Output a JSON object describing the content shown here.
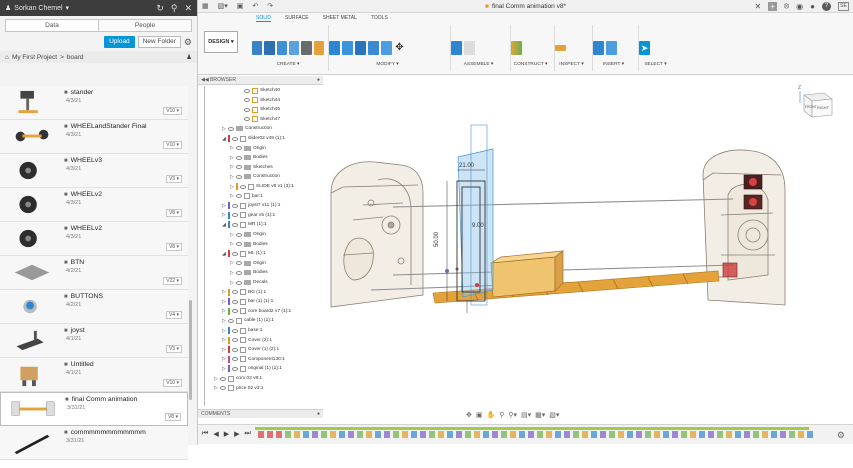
{
  "data_panel": {
    "user": "Sorkan Chemel",
    "tabs": [
      "Data",
      "People"
    ],
    "upload_label": "Upload",
    "new_folder_label": "New Folder",
    "breadcrumb": [
      "My First Project",
      "board"
    ],
    "files": [
      {
        "name": "stander",
        "date": "4/3/21",
        "version": "V10",
        "thumb": "stander"
      },
      {
        "name": "WHEELandStander Final",
        "date": "4/3/21",
        "version": "V10",
        "thumb": "wheels"
      },
      {
        "name": "WHEELv3",
        "date": "4/3/21",
        "version": "V3",
        "thumb": "wheel"
      },
      {
        "name": "WHEELv2",
        "date": "4/3/21",
        "version": "V8",
        "thumb": "wheel"
      },
      {
        "name": "WHEELv2",
        "date": "4/3/21",
        "version": "V8",
        "thumb": "wheel"
      },
      {
        "name": "BTN",
        "date": "4/2/21",
        "version": "V22",
        "thumb": "plate"
      },
      {
        "name": "BUTTONS",
        "date": "4/2/21",
        "version": "V4",
        "thumb": "button"
      },
      {
        "name": "joyst",
        "date": "4/1/21",
        "version": "V3",
        "thumb": "joyst"
      },
      {
        "name": "Untitled",
        "date": "4/1/21",
        "version": "V10",
        "thumb": "robot"
      },
      {
        "name": "final Comm animation",
        "date": "3/31/21",
        "version": "V8",
        "thumb": "anim",
        "selected": true
      },
      {
        "name": "commmmmmmmmmmm",
        "date": "3/31/21",
        "version": "",
        "thumb": "pen"
      }
    ]
  },
  "app": {
    "document_title": "final Comm animation v8*",
    "workspace_button": "DESIGN",
    "ribbon_tabs": [
      "SOLID",
      "SURFACE",
      "SHEET METAL",
      "TOOLS"
    ],
    "active_tab": "SOLID",
    "groups": [
      "CREATE",
      "MODIFY",
      "ASSEMBLE",
      "CONSTRUCT",
      "INSPECT",
      "INSERT",
      "SELECT"
    ],
    "browser_title": "BROWSER",
    "comments_label": "COMMENTS",
    "viewcube_labels": {
      "front": "FRONT",
      "right": "RIGHT",
      "z": "Z"
    },
    "dimensions": {
      "width": "21.00",
      "height": "50.00",
      "side": "9.00"
    },
    "tree": [
      {
        "label": "Sketch40",
        "depth": 3,
        "type": "sketch"
      },
      {
        "label": "Sketch44",
        "depth": 3,
        "type": "sketch"
      },
      {
        "label": "Sketch45",
        "depth": 3,
        "type": "sketch"
      },
      {
        "label": "Sketch47",
        "depth": 3,
        "type": "sketch"
      },
      {
        "label": "Construction",
        "depth": 1,
        "type": "folder",
        "tri": "▷"
      },
      {
        "label": "slider02 v49 (1):1",
        "depth": 1,
        "type": "comp",
        "tri": "◢",
        "color": "#d43d3d"
      },
      {
        "label": "Origin",
        "depth": 2,
        "type": "folder",
        "tri": "▷"
      },
      {
        "label": "Bodies",
        "depth": 2,
        "type": "folder",
        "tri": "▷"
      },
      {
        "label": "Sketches",
        "depth": 2,
        "type": "folder",
        "tri": "▷"
      },
      {
        "label": "Construction",
        "depth": 2,
        "type": "folder",
        "tri": "▷"
      },
      {
        "label": "SLIDE v8 v1 (3):1",
        "depth": 2,
        "type": "comp",
        "tri": "▷",
        "color": "#e39a1e"
      },
      {
        "label": "bar:1",
        "depth": 2,
        "type": "comp",
        "tri": "▷"
      },
      {
        "label": "joyst7 v11 (1):1",
        "depth": 1,
        "type": "comp",
        "tri": "▷",
        "color": "#7b5cc9"
      },
      {
        "label": "gear v5 (1):1",
        "depth": 1,
        "type": "comp",
        "tri": "▷",
        "color": "#2d86d2"
      },
      {
        "label": "MR (1):1",
        "depth": 1,
        "type": "comp",
        "tri": "◢",
        "color": "#2d86d2"
      },
      {
        "label": "Origin",
        "depth": 2,
        "type": "folder",
        "tri": "▷"
      },
      {
        "label": "Bodies",
        "depth": 2,
        "type": "folder",
        "tri": "▷"
      },
      {
        "label": "ML (1):1",
        "depth": 1,
        "type": "comp",
        "tri": "◢",
        "color": "#d43d3d"
      },
      {
        "label": "Origin",
        "depth": 2,
        "type": "folder",
        "tri": "▷"
      },
      {
        "label": "Bodies",
        "depth": 2,
        "type": "folder",
        "tri": "▷"
      },
      {
        "label": "Decals",
        "depth": 2,
        "type": "folder",
        "tri": "▷"
      },
      {
        "label": "BG (1):1",
        "depth": 1,
        "type": "comp",
        "tri": "▷",
        "color": "#e39a1e"
      },
      {
        "label": "bar (1) (1):1",
        "depth": 1,
        "type": "comp",
        "tri": "▷",
        "color": "#7b5cc9"
      },
      {
        "label": "core board2 v7 (1):1",
        "depth": 1,
        "type": "comp",
        "tri": "▷",
        "color": "#6ab04c"
      },
      {
        "label": "cable (1) (1):1",
        "depth": 1,
        "type": "comp",
        "tri": "▷"
      },
      {
        "label": "base:1",
        "depth": 1,
        "type": "comp",
        "tri": "▷",
        "color": "#2d86d2"
      },
      {
        "label": "Cover (2):1",
        "depth": 1,
        "type": "comp",
        "tri": "▷",
        "color": "#e39a1e"
      },
      {
        "label": "Cover (1) (2):1",
        "depth": 1,
        "type": "comp",
        "tri": "▷",
        "color": "#d43d3d"
      },
      {
        "label": "Component130:1",
        "depth": 1,
        "type": "comp",
        "tri": "▷",
        "color": "#c44a9a"
      },
      {
        "label": "original (1) (1):1",
        "depth": 1,
        "type": "comp",
        "tri": "▷",
        "color": "#7b5cc9"
      },
      {
        "label": "com 03 v8:1",
        "depth": 0,
        "type": "comp",
        "tri": "▷"
      },
      {
        "label": "price 02 v3:1",
        "depth": 0,
        "type": "comp",
        "tri": "▷"
      }
    ]
  },
  "colors": {
    "accent": "#0696d7",
    "dark_header": "#3d3d3d",
    "timeline_green": "#9bcf4a"
  }
}
